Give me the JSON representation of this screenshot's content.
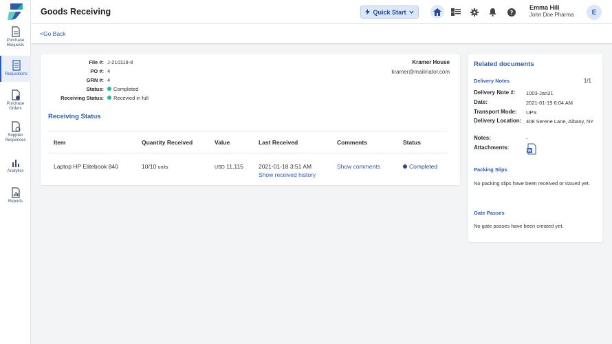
{
  "sidebar": {
    "items": [
      {
        "label_line1": "Purchase",
        "label_line2": "Requests",
        "icon": "document-icon",
        "active": false
      },
      {
        "label_line1": "Requisitions",
        "label_line2": "",
        "icon": "list-document-icon",
        "active": true
      },
      {
        "label_line1": "Purchase",
        "label_line2": "Orders",
        "icon": "order-document-icon",
        "active": false
      },
      {
        "label_line1": "Supplier",
        "label_line2": "Responses",
        "icon": "response-document-icon",
        "active": false
      },
      {
        "label_line1": "Analytics",
        "label_line2": "",
        "icon": "bar-chart-icon",
        "active": false
      },
      {
        "label_line1": "Reports",
        "label_line2": "",
        "icon": "report-icon",
        "active": false
      }
    ]
  },
  "header": {
    "title": "Goods Receiving",
    "quick_start_label": "Quick Start",
    "user_name": "Emma Hill",
    "user_org": "John Doe Pharma",
    "avatar_initial": "E"
  },
  "subbar": {
    "go_back_label": "<Go Back"
  },
  "details": {
    "file_label": "File #:",
    "file_value": "J-210118-8",
    "po_label": "PO #:",
    "po_value": "4",
    "grn_label": "GRN #:",
    "grn_value": "4",
    "status_label": "Status:",
    "status_value": "Completed",
    "receiving_status_label": "Receiving Status:",
    "receiving_status_value": "Recevied in full"
  },
  "supplier": {
    "name": "Kramer House",
    "email": "kramer@mailinator.com"
  },
  "receiving": {
    "section_title": "Receiving Status",
    "columns": [
      "Item",
      "Quantity Received",
      "Value",
      "Last Received",
      "Comments",
      "Status"
    ],
    "row": {
      "item": "Laptop HP Elitebook 840",
      "quantity": "10/10",
      "quantity_unit": "units",
      "value_currency": "USD",
      "value_amount": "11,115",
      "last_received": "2021-01-18 3:51 AM",
      "history_link": "Show received history",
      "comments_link": "Show comments",
      "status": "Completed"
    }
  },
  "related": {
    "title": "Related documents",
    "delivery_notes_title": "Delivery Notes",
    "pager": "1/1",
    "delivery_note_label": "Delivery Note #:",
    "delivery_note_value": "1003-Jan21",
    "date_label": "Date:",
    "date_value": "2021-01-19 6:04 AM",
    "transport_label": "Transport Mode:",
    "transport_value": "UPS",
    "location_label": "Delivery Location:",
    "location_value": "408 Serene Lane, Albany, NY",
    "notes_label": "Notes:",
    "notes_value": "-",
    "attachments_label": "Attachments:",
    "attachment_icon": "word-document-icon",
    "packing_slips_title": "Packing Slips",
    "packing_slips_text": "No packing slips have been received or issued yet.",
    "gate_passes_title": "Gate Passes",
    "gate_passes_text": "No gate passes have been created yet."
  },
  "colors": {
    "accent": "#2b5bb5",
    "status_green": "#1fb8a6",
    "status_blue": "#214a9a"
  }
}
